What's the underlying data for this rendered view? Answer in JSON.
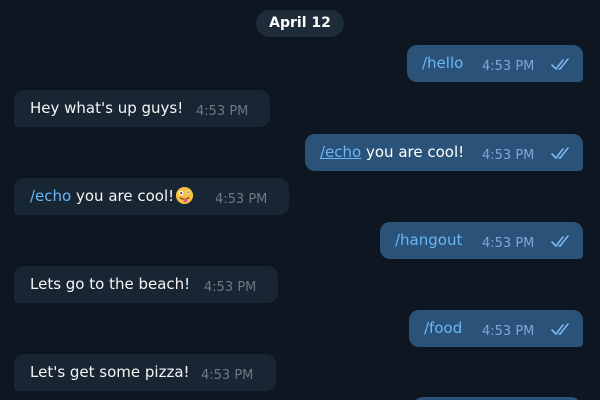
{
  "chat": {
    "date_divider": "April 12",
    "messages": [
      {
        "direction": "outgoing",
        "parts": [
          {
            "text": "/hello",
            "style": "command"
          }
        ],
        "time": "4:53 PM",
        "status_icon": "double-check-icon"
      },
      {
        "direction": "incoming",
        "parts": [
          {
            "text": "Hey what's up guys!",
            "style": "plain"
          }
        ],
        "time": "4:53 PM"
      },
      {
        "direction": "outgoing",
        "parts": [
          {
            "text": "/echo",
            "style": "command-link"
          },
          {
            "text": " you are cool!",
            "style": "plain"
          }
        ],
        "time": "4:53 PM",
        "status_icon": "double-check-icon"
      },
      {
        "direction": "incoming",
        "parts": [
          {
            "text": "/echo",
            "style": "command"
          },
          {
            "text": " you are cool!",
            "style": "plain"
          }
        ],
        "emoji": "zany-face-emoji",
        "time": "4:53 PM"
      },
      {
        "direction": "outgoing",
        "parts": [
          {
            "text": "/hangout",
            "style": "command"
          }
        ],
        "time": "4:53 PM",
        "status_icon": "double-check-icon"
      },
      {
        "direction": "incoming",
        "parts": [
          {
            "text": "Lets go to the beach!",
            "style": "plain"
          }
        ],
        "time": "4:53 PM"
      },
      {
        "direction": "outgoing",
        "parts": [
          {
            "text": "/food",
            "style": "command"
          }
        ],
        "time": "4:53 PM",
        "status_icon": "double-check-icon"
      },
      {
        "direction": "incoming",
        "parts": [
          {
            "text": "Let's get some pizza!",
            "style": "plain"
          }
        ],
        "time": "4:53 PM"
      }
    ]
  },
  "colors": {
    "background": "#0e1621",
    "incoming_bubble": "#182533",
    "outgoing_bubble": "#2b5278",
    "command_text": "#6ab7f5",
    "date_pill": "#1e2c3a"
  }
}
